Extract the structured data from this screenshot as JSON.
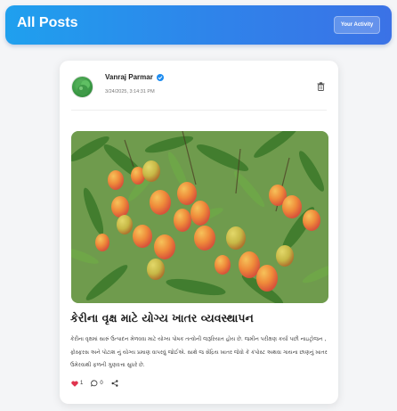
{
  "header": {
    "title": "All Posts",
    "activity_button": "Your Activity",
    "gradient_colors": [
      "#1fa0ee",
      "#3b72e6"
    ]
  },
  "post": {
    "author": "Vanraj Parmar",
    "verified": true,
    "timestamp": "3/24/2025, 3:14:31 PM",
    "image_subject": "mango tree with ripe mangoes",
    "title": "કેરીના વૃક્ષ માટે યોગ્ય ખાતર વ્યવસ્થાપન",
    "body": "કેરીના વૃક્ષમાં સારું ઉત્પાદન મેળવવા માટે યોગ્ય પોષક તત્વોની જરૂરિયાત હોય છે. જમીન પરીક્ષણ કર્યા પછી નાઇટ્રોજન , ફોસ્ફરસ અને પોટાશ નું યોગ્ય પ્રમાણ વાપરવું જોઈએ. સાથે જ સેંદ્રિય ખાતર જેવો કે કંપોસ્ટ અથવા ગાયના છાણનું ખાતર ઉમેરવાથી ફળની ગુણવત્તા સુધરે છે.",
    "likes": "1",
    "comments": "0",
    "accent_like": "#e0344f",
    "accent_verified": "#1d8cf0"
  },
  "icons": [
    "verified-badge-icon",
    "trash-icon",
    "heart-icon",
    "comment-icon",
    "share-icon"
  ]
}
